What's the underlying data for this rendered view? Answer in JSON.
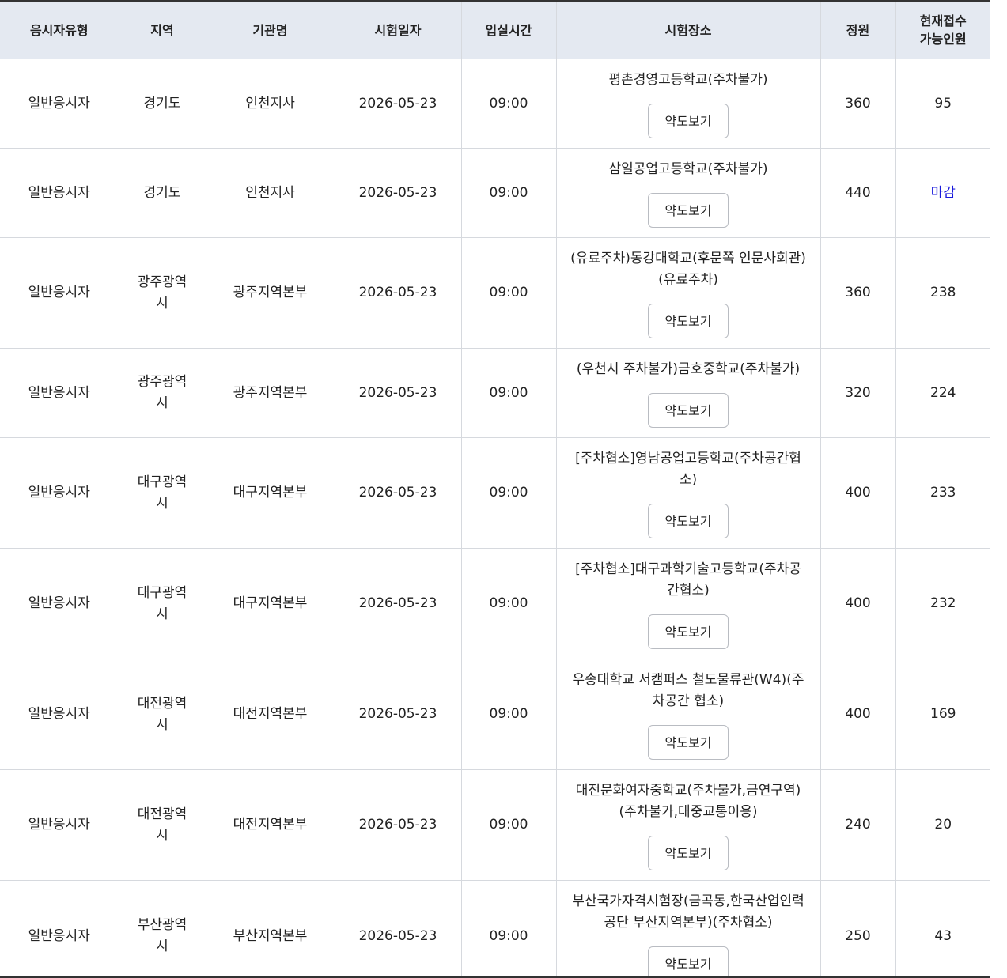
{
  "table": {
    "headers": [
      "응시자유형",
      "지역",
      "기관명",
      "시험일자",
      "입실시간",
      "시험장소",
      "정원",
      "현재접수\n가능인원"
    ],
    "rows": [
      {
        "type": "일반응시자",
        "region": "경기도",
        "agency": "인천지사",
        "date": "2026-05-23",
        "time": "09:00",
        "venue": "평촌경영고등학교(주차불가)",
        "map_label": "약도보기",
        "capacity": "360",
        "available": "95"
      },
      {
        "type": "일반응시자",
        "region": "경기도",
        "agency": "인천지사",
        "date": "2026-05-23",
        "time": "09:00",
        "venue": "삼일공업고등학교(주차불가)",
        "map_label": "약도보기",
        "capacity": "440",
        "available": "마감"
      },
      {
        "type": "일반응시자",
        "region": "광주광역시",
        "agency": "광주지역본부",
        "date": "2026-05-23",
        "time": "09:00",
        "venue": "(유료주차)동강대학교(후문쪽 인문사회관)(유료주차)",
        "map_label": "약도보기",
        "capacity": "360",
        "available": "238"
      },
      {
        "type": "일반응시자",
        "region": "광주광역시",
        "agency": "광주지역본부",
        "date": "2026-05-23",
        "time": "09:00",
        "venue": "(우천시 주차불가)금호중학교(주차불가)",
        "map_label": "약도보기",
        "capacity": "320",
        "available": "224"
      },
      {
        "type": "일반응시자",
        "region": "대구광역시",
        "agency": "대구지역본부",
        "date": "2026-05-23",
        "time": "09:00",
        "venue": "[주차협소]영남공업고등학교(주차공간협소)",
        "map_label": "약도보기",
        "capacity": "400",
        "available": "233"
      },
      {
        "type": "일반응시자",
        "region": "대구광역시",
        "agency": "대구지역본부",
        "date": "2026-05-23",
        "time": "09:00",
        "venue": "[주차협소]대구과학기술고등학교(주차공간협소)",
        "map_label": "약도보기",
        "capacity": "400",
        "available": "232"
      },
      {
        "type": "일반응시자",
        "region": "대전광역시",
        "agency": "대전지역본부",
        "date": "2026-05-23",
        "time": "09:00",
        "venue": "우송대학교 서캠퍼스 철도물류관(W4)(주차공간 협소)",
        "map_label": "약도보기",
        "capacity": "400",
        "available": "169"
      },
      {
        "type": "일반응시자",
        "region": "대전광역시",
        "agency": "대전지역본부",
        "date": "2026-05-23",
        "time": "09:00",
        "venue": "대전문화여자중학교(주차불가,금연구역)(주차불가,대중교통이용)",
        "map_label": "약도보기",
        "capacity": "240",
        "available": "20"
      },
      {
        "type": "일반응시자",
        "region": "부산광역시",
        "agency": "부산지역본부",
        "date": "2026-05-23",
        "time": "09:00",
        "venue": "부산국가자격시험장(금곡동,한국산업인력공단 부산지역본부)(주차협소)",
        "map_label": "약도보기",
        "capacity": "250",
        "available": "43"
      }
    ]
  },
  "colors": {
    "header_bg": "#e4e9f1",
    "border": "#d6d9de",
    "closed_text": "#1a1adc"
  }
}
